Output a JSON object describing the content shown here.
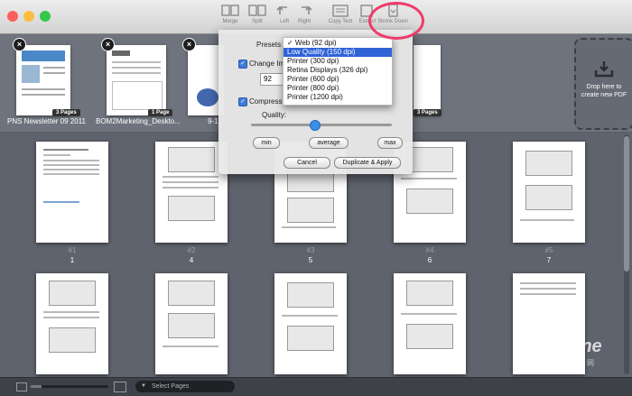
{
  "toolbar": {
    "buttons": [
      {
        "label": "Merge"
      },
      {
        "label": "Split"
      },
      {
        "label": "Left"
      },
      {
        "label": "Right"
      },
      {
        "label": "Copy Text"
      },
      {
        "label": "Extract"
      },
      {
        "label": "Shrink Down"
      }
    ]
  },
  "documents": [
    {
      "name": "PNS Newsletter 09 2011",
      "pages": "3 Pages"
    },
    {
      "name": "BOM2Marketing_Deskto...",
      "pages": "1 Page"
    },
    {
      "name": "9-1...",
      "pages": ""
    },
    {
      "name": "",
      "pages": "3 Pages"
    }
  ],
  "dropzone": {
    "text": "Drop here to create new PDF"
  },
  "dialog": {
    "presets_label": "Presets",
    "change_label": "Change Im",
    "change_value": "92",
    "compress_label": "Compress",
    "quality_label": "Quality:",
    "quality_level": 0.45,
    "min_label": "min",
    "average_label": "average",
    "max_label": "max",
    "cancel_label": "Cancel",
    "apply_label": "Duplicate & Apply"
  },
  "presets_menu": {
    "items": [
      {
        "label": "✓ Web (92 dpi)",
        "selected": false
      },
      {
        "label": "Low Quality (150 dpi)",
        "selected": true
      },
      {
        "label": "Printer (300 dpi)",
        "selected": false
      },
      {
        "label": "Retina Displays (326 dpi)",
        "selected": false
      },
      {
        "label": "Printer (600 dpi)",
        "selected": false
      },
      {
        "label": "Printer (800 dpi)",
        "selected": false
      },
      {
        "label": "Printer (1200 dpi)",
        "selected": false
      }
    ]
  },
  "pages_row1": [
    {
      "num": "#1",
      "label": "1"
    },
    {
      "num": "#2",
      "label": "4"
    },
    {
      "num": "#3",
      "label": "5"
    },
    {
      "num": "#4",
      "label": "6"
    },
    {
      "num": "#5",
      "label": "7"
    }
  ],
  "bottom": {
    "select_pages": "Select Pages"
  },
  "watermark": {
    "brand": "PConline",
    "sub": "太平洋电脑网"
  },
  "colors": {
    "accent": "#2f63d6",
    "highlight_circle": "#ef3a6a"
  }
}
